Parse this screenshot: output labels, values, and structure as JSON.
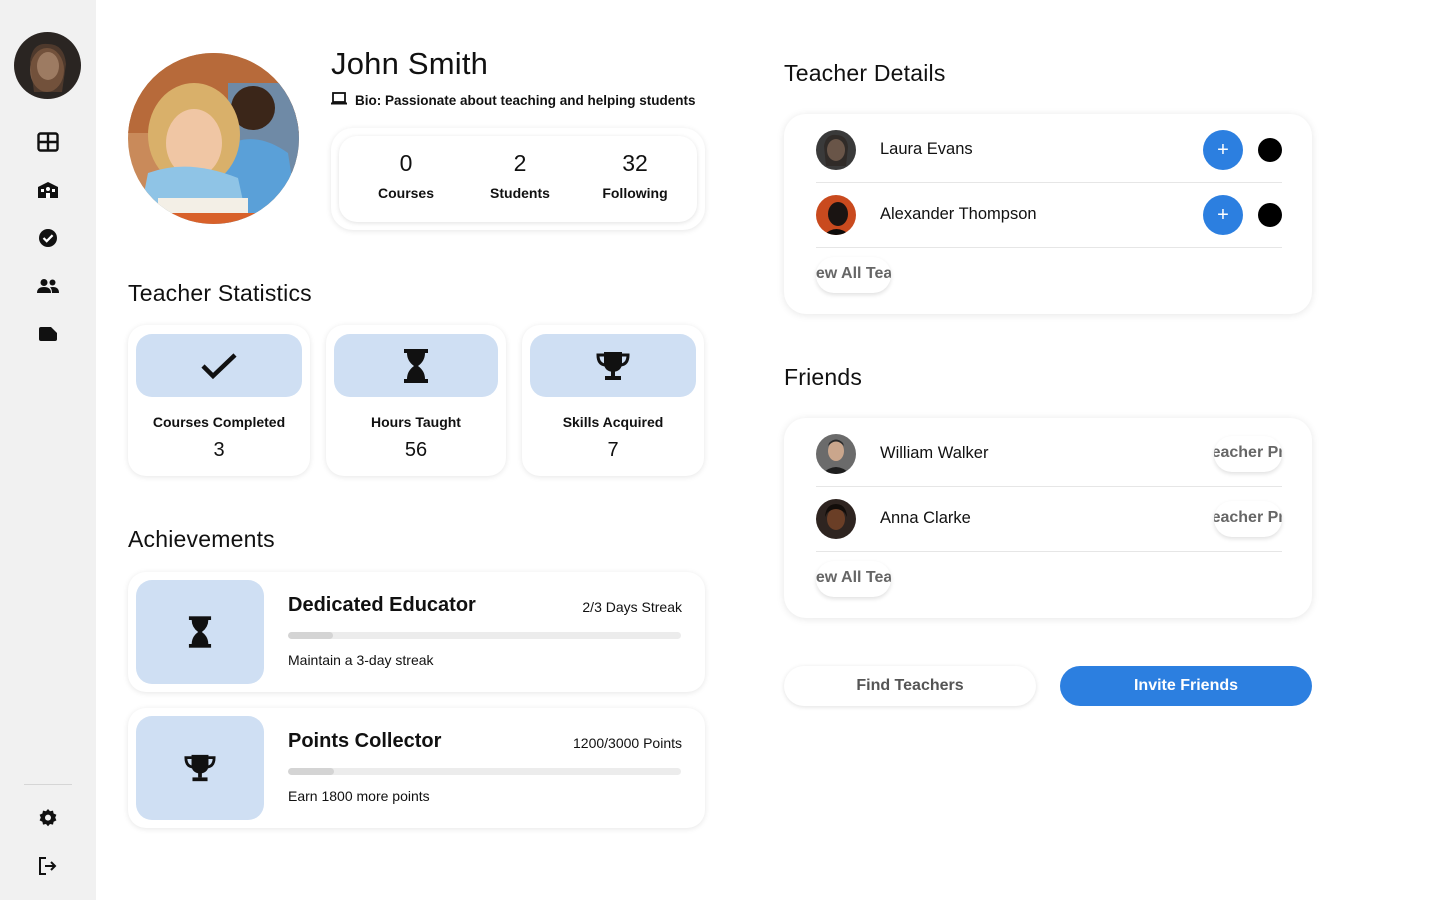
{
  "profile": {
    "name": "John Smith",
    "bio": "Bio: Passionate about teaching and helping students",
    "stats": [
      {
        "value": "0",
        "label": "Courses"
      },
      {
        "value": "2",
        "label": "Students"
      },
      {
        "value": "32",
        "label": "Following"
      }
    ]
  },
  "sidebar": {
    "items": [
      {
        "icon": "dashboard-icon"
      },
      {
        "icon": "school-icon"
      },
      {
        "icon": "check-circle-icon"
      },
      {
        "icon": "people-icon"
      },
      {
        "icon": "folder-icon"
      }
    ],
    "bottom": [
      {
        "icon": "gear-icon"
      },
      {
        "icon": "logout-icon"
      }
    ]
  },
  "statistics": {
    "title": "Teacher Statistics",
    "cards": [
      {
        "icon": "check-icon",
        "label": "Courses Completed",
        "value": "3"
      },
      {
        "icon": "hourglass-icon",
        "label": "Hours Taught",
        "value": "56"
      },
      {
        "icon": "trophy-icon",
        "label": "Skills Acquired",
        "value": "7"
      }
    ]
  },
  "achievements": {
    "title": "Achievements",
    "items": [
      {
        "icon": "hourglass-icon",
        "title": "Dedicated Educator",
        "meta": "2/3 Days Streak",
        "progress": 0.115,
        "desc": "Maintain a 3-day streak"
      },
      {
        "icon": "trophy-icon",
        "title": "Points Collector",
        "meta": "1200/3000 Points",
        "progress": 0.118,
        "desc": "Earn 1800 more points"
      }
    ]
  },
  "teachers": {
    "title": "Teacher Details",
    "rows": [
      {
        "name": "Laura Evans"
      },
      {
        "name": "Alexander Thompson"
      }
    ],
    "view_all": "View All Teachers"
  },
  "friends": {
    "title": "Friends",
    "rows": [
      {
        "name": "William Walker",
        "action": "Teacher Profile"
      },
      {
        "name": "Anna Clarke",
        "action": "Teacher Profile"
      }
    ],
    "view_all": "View All Teachers"
  },
  "actions": {
    "find": "Find Teachers",
    "invite": "Invite Friends"
  },
  "colors": {
    "accent": "#2c7fe0",
    "icon_bg": "#cfdff3",
    "sidebar_bg": "#f1f1f1"
  }
}
